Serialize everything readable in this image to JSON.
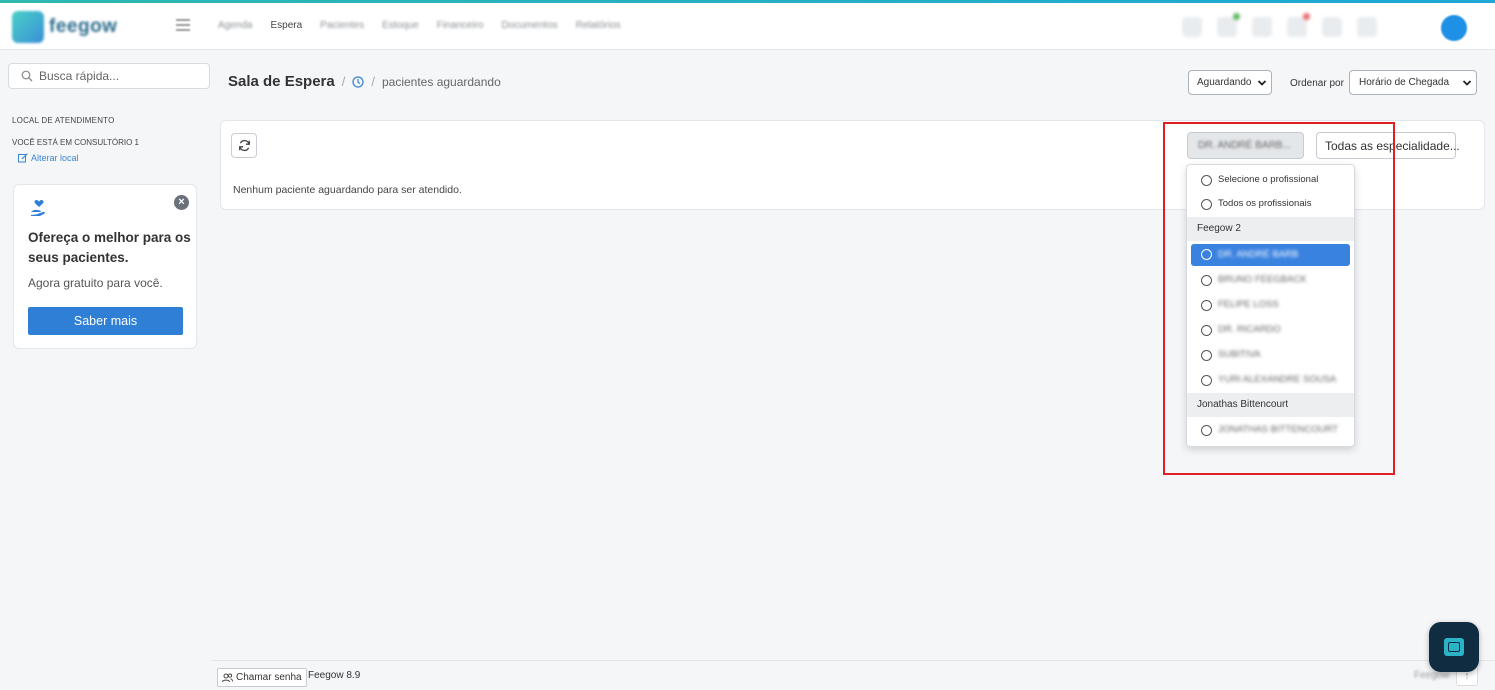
{
  "app": {
    "logo_text": "feegow"
  },
  "nav": {
    "items": [
      "Agenda",
      "Espera",
      "Pacientes",
      "Estoque",
      "Financeiro",
      "Documentos",
      "Relatórios"
    ],
    "active": "Espera"
  },
  "sidebar": {
    "search_placeholder": "Busca rápida...",
    "section_title": "LOCAL DE ATENDIMENTO",
    "location_text": "VOCÊ ESTÁ EM CONSULTÓRIO 1",
    "change_location_label": "Alterar local",
    "promo": {
      "title": "Ofereça o melhor para os seus pacientes.",
      "subtitle": "Agora gratuito para você.",
      "button_label": "Saber mais"
    }
  },
  "header": {
    "title": "Sala de Espera",
    "subtitle": "pacientes aguardando",
    "status_select": "Aguardando",
    "order_label": "Ordenar por",
    "order_select": "Horário de Chegada"
  },
  "panel": {
    "empty_message": "Nenhum paciente aguardando para ser atendido.",
    "professional_button": "DR. ANDRÉ BARB...",
    "specialty_button": "Todas as especialidade..."
  },
  "dropdown": {
    "options_top": [
      "Selecione o profissional",
      "Todos os profissionais"
    ],
    "group_1": {
      "label": "Feegow 2",
      "items": [
        "DR. ANDRÉ BARB",
        "BRUNO FEEGBACK",
        "FELIPE LOSS",
        "DR. RICARDO",
        "SUBITIVA",
        "YURI ALEXANDRE SOUSA"
      ]
    },
    "group_2": {
      "label": "Jonathas Bittencourt",
      "items": [
        "JONATHAS BITTENCOURT"
      ]
    }
  },
  "footer": {
    "call_label": "Chamar senha",
    "version": "Feegow 8.9",
    "right_label": "Feegow"
  },
  "colors": {
    "accent": "#2f7fd6",
    "highlight": "#3a82e0",
    "annotation": "#e02020"
  }
}
